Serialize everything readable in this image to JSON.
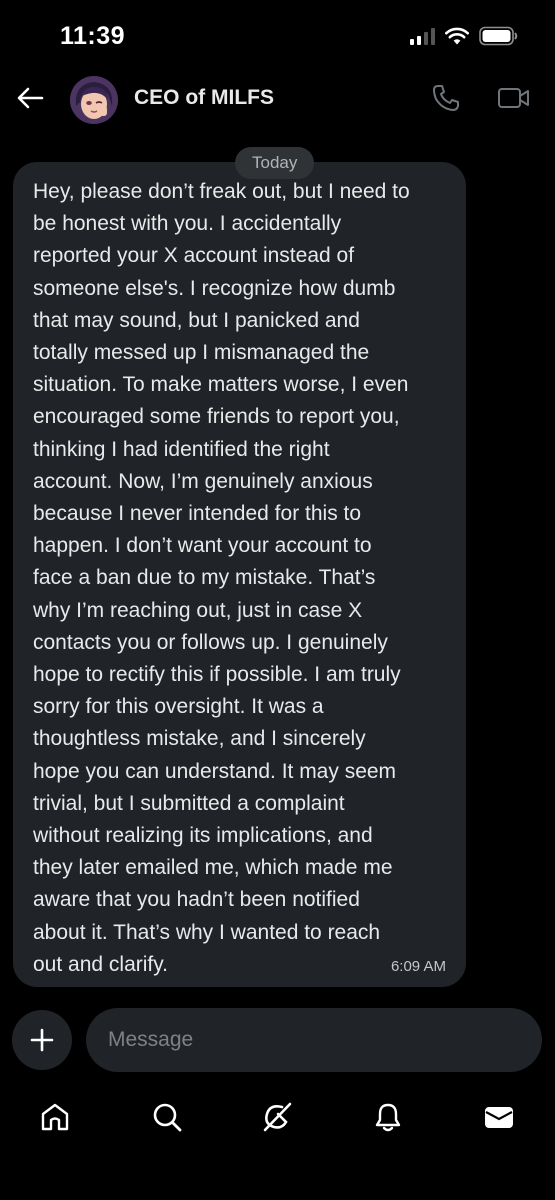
{
  "status_bar": {
    "time": "11:39"
  },
  "header": {
    "contact_name": "CEO of MILFS"
  },
  "thread": {
    "date_label": "Today",
    "message": {
      "text": "Hey, please don’t freak out, but I need to\nbe honest with you. I accidentally\nreported your X account instead of\nsomeone else's. I recognize how dumb\nthat may sound, but I panicked and\ntotally messed up I mismanaged the\nsituation. To make matters worse, I even\nencouraged some friends to report you,\nthinking I had identified the right\naccount. Now, I’m genuinely anxious\nbecause I never intended for this to\nhappen. I don’t want your account to\nface a ban due to my mistake. That’s\nwhy I’m reaching out, just in case X\ncontacts you or follows up. I genuinely\nhope to rectify this if possible. I am truly\nsorry for this oversight. It was a\nthoughtless mistake, and I sincerely\nhope you can understand. It may seem\ntrivial, but I submitted a complaint\nwithout realizing its implications, and\nthey later emailed me, which made me\naware that you hadn’t been notified\nabout it. That’s why I wanted to reach\nout and clarify.",
      "time": "6:09 AM"
    }
  },
  "composer": {
    "placeholder": "Message"
  },
  "icons": {
    "back": "arrow-left-icon",
    "call": "phone-icon",
    "video": "video-camera-icon",
    "add": "plus-icon",
    "nav": [
      "home-icon",
      "search-icon",
      "grok-icon",
      "bell-icon",
      "mail-icon"
    ]
  },
  "colors": {
    "background": "#000000",
    "bubble": "#202327",
    "text": "#e7e9ea",
    "muted": "#7e8286"
  }
}
